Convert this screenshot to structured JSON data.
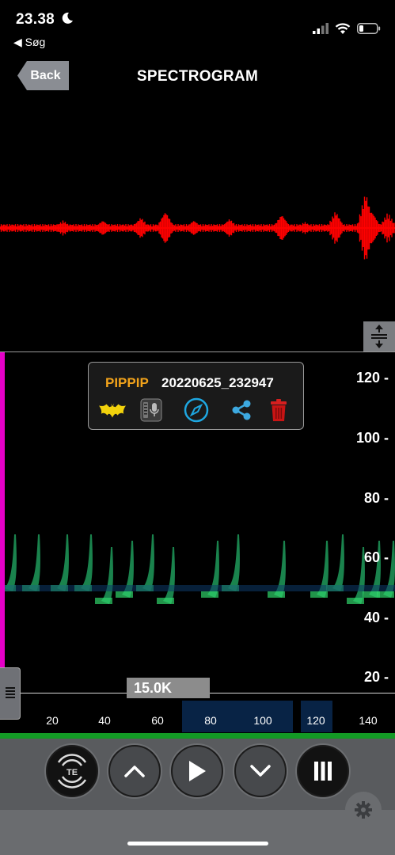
{
  "status_bar": {
    "time": "23.38",
    "back_app": "◀ Søg"
  },
  "nav": {
    "back_label": "Back",
    "title": "SPECTROGRAM"
  },
  "info_box": {
    "species": "PIPPIP",
    "filename": "20220625_232947",
    "icons": [
      "bat-icon",
      "voice-memo-icon",
      "compass-icon",
      "share-icon",
      "trash-icon"
    ]
  },
  "spectrogram": {
    "y_ticks": [
      "120 -",
      "100 -",
      "80 -",
      "60 -",
      "40 -",
      "20 -"
    ],
    "x_ticks": [
      "20",
      "40",
      "60",
      "80",
      "100",
      "120",
      "140"
    ],
    "frequency_marker": "15.0K"
  },
  "controls": {
    "buttons": [
      "te-mode-button",
      "scroll-up-button",
      "play-button",
      "scroll-down-button",
      "pause-bars-button"
    ],
    "te_label": "TE"
  },
  "colors": {
    "waveform": "#ff0000",
    "marker_bar": "#e600c8",
    "species_text": "#f2a31b",
    "call_green": "#23c25a"
  }
}
